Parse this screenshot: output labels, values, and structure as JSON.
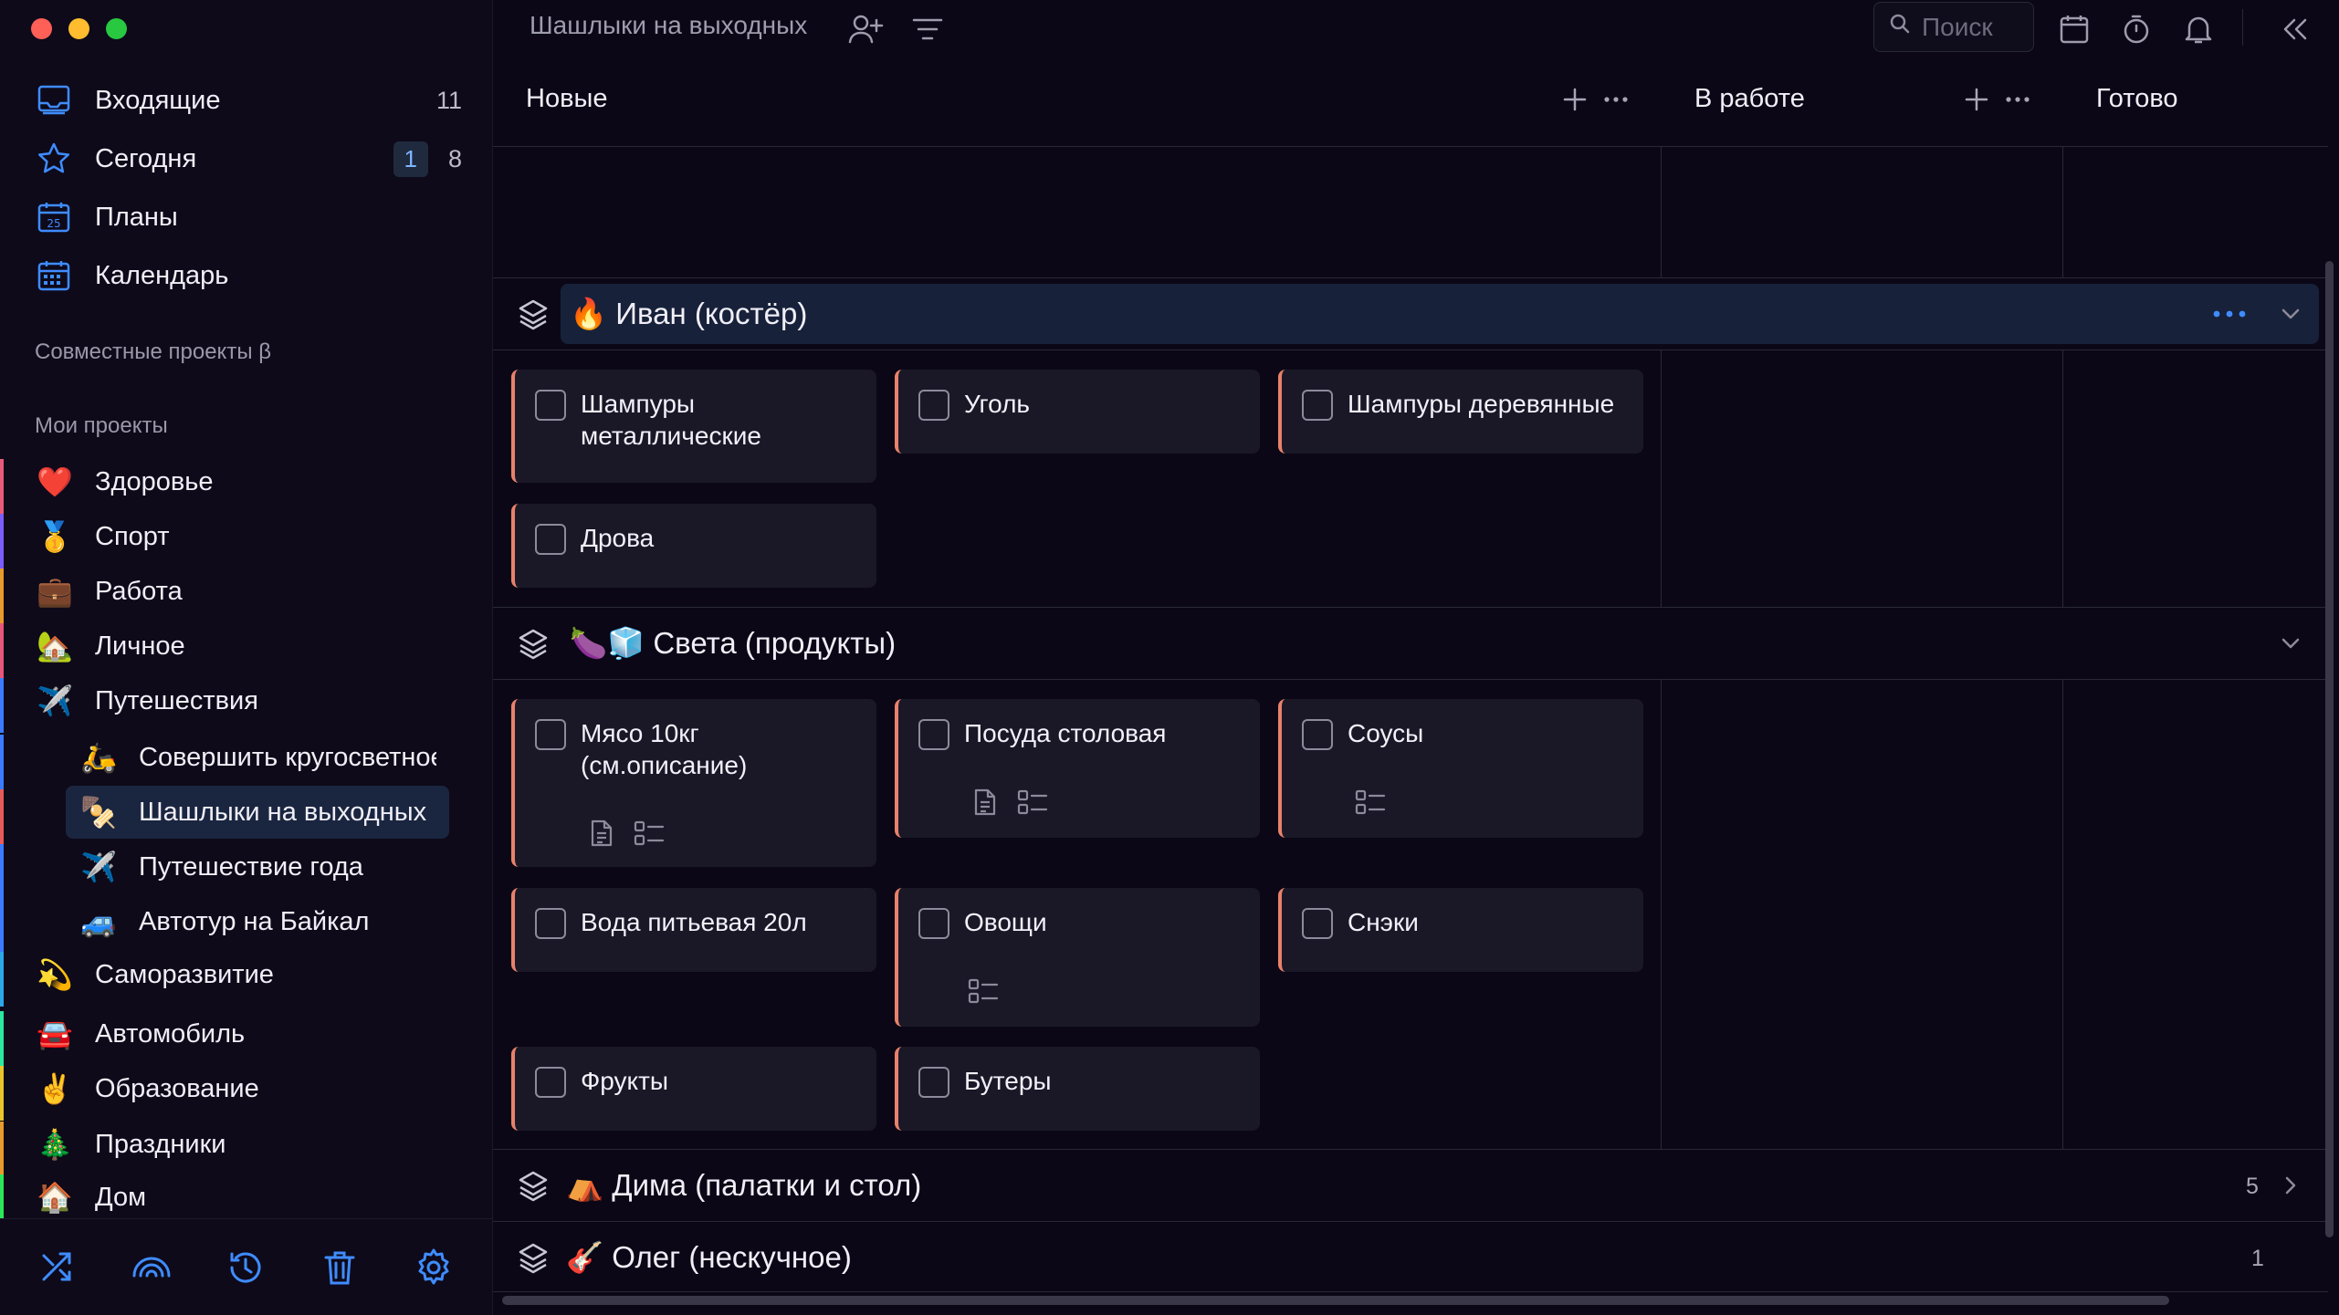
{
  "sidebar": {
    "nav": [
      {
        "label": "Входящие",
        "count": "11",
        "icon": "inbox-icon"
      },
      {
        "label": "Сегодня",
        "badge": "1",
        "count": "8",
        "icon": "star-icon"
      },
      {
        "label": "Планы",
        "icon": "calendar-day-icon"
      },
      {
        "label": "Календарь",
        "icon": "calendar-grid-icon"
      }
    ],
    "shared_label": "Совместные проекты β",
    "my_label": "Мои проекты",
    "projects": [
      {
        "label": "Здоровье",
        "emoji": "❤️",
        "color": "#e85a7a"
      },
      {
        "label": "Спорт",
        "emoji": "🥇",
        "color": "#7b5cff"
      },
      {
        "label": "Работа",
        "emoji": "💼",
        "color": "#e89a2a"
      },
      {
        "label": "Личное",
        "emoji": "🏡",
        "color": "#e8577a"
      },
      {
        "label": "Путешествия",
        "emoji": "✈️",
        "color": "#3a7bff"
      },
      {
        "label": "Совершить кругосветное",
        "emoji": "🛵",
        "color": "#3a7bff"
      },
      {
        "label": "Шашлыки на выходных",
        "emoji": "🍢",
        "color": "#e85a5a"
      },
      {
        "label": "Путешествие года",
        "emoji": "✈️",
        "color": "#3a7bff"
      },
      {
        "label": "Автотур на Байкал",
        "emoji": "🚙",
        "color": "#3a7bff"
      },
      {
        "label": "Саморазвитие",
        "emoji": "💫",
        "color": "#2aa8e8"
      },
      {
        "label": "Автомобиль",
        "emoji": "🚘",
        "color": "#2ae8a0"
      },
      {
        "label": "Образование",
        "emoji": "✌️",
        "color": "#e8c62a"
      },
      {
        "label": "Праздники",
        "emoji": "🎄",
        "color": "#e89a2a"
      },
      {
        "label": "Дом",
        "emoji": "🏠",
        "color": "#2ae85a"
      }
    ]
  },
  "board": {
    "title": "Шашлыки на выходных",
    "search_placeholder": "Поиск",
    "columns": [
      "Новые",
      "В работе",
      "Готово"
    ],
    "groups": [
      {
        "title": "🔥 Иван (костёр)",
        "count": ""
      },
      {
        "title": "🍆🧊 Света (продукты)",
        "count": ""
      },
      {
        "title": "⛺ Дима (палатки и стол)",
        "count": "5"
      },
      {
        "title": "🎸 Олег (нескучное)",
        "count": "1"
      }
    ],
    "ivan_cards": [
      "Шампуры металлические",
      "Уголь",
      "Шампуры деревянные",
      "Дрова"
    ],
    "sveta_cards": [
      "Мясо 10кг (см.описание)",
      "Посуда столовая",
      "Соусы",
      "Вода питьевая 20л",
      "Овощи",
      "Снэки",
      "Фрукты",
      "Бутеры"
    ]
  }
}
